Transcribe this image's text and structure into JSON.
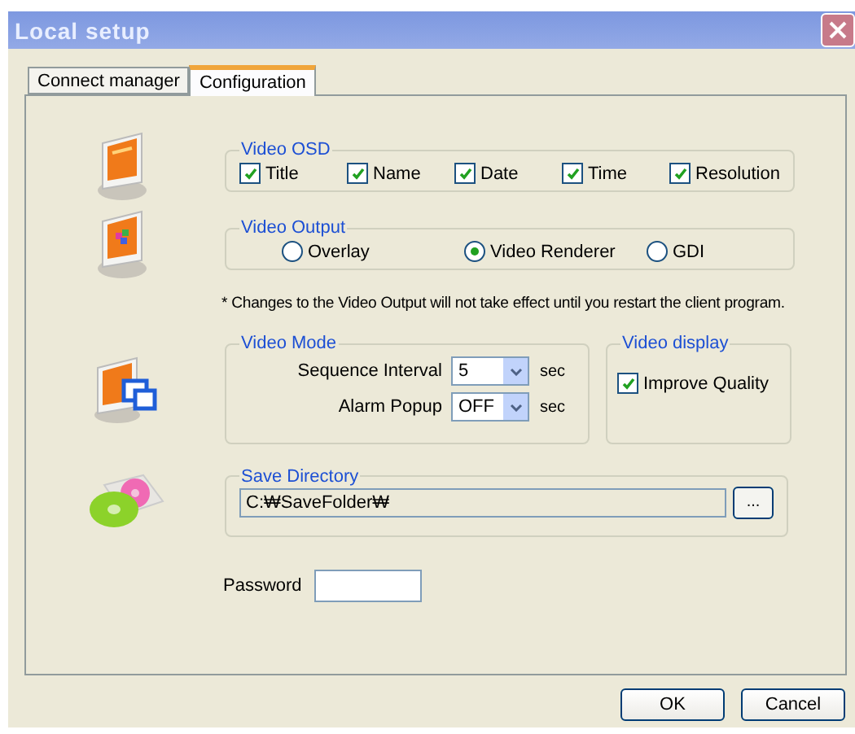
{
  "window": {
    "title": "Local setup"
  },
  "tabs": [
    {
      "label": "Connect manager",
      "selected": false
    },
    {
      "label": "Configuration",
      "selected": true
    }
  ],
  "video_osd": {
    "title": "Video OSD",
    "options": [
      {
        "label": "Title",
        "checked": true
      },
      {
        "label": "Name",
        "checked": true
      },
      {
        "label": "Date",
        "checked": true
      },
      {
        "label": "Time",
        "checked": true
      },
      {
        "label": "Resolution",
        "checked": true
      }
    ]
  },
  "video_output": {
    "title": "Video Output",
    "options": [
      {
        "label": "Overlay",
        "selected": false
      },
      {
        "label": "Video Renderer",
        "selected": true
      },
      {
        "label": "GDI",
        "selected": false
      }
    ]
  },
  "note": "* Changes to the Video Output will not take effect until you restart the client program.",
  "video_mode": {
    "title": "Video Mode",
    "fields": [
      {
        "label": "Sequence Interval",
        "value": "5",
        "unit": "sec"
      },
      {
        "label": "Alarm Popup",
        "value": "OFF",
        "unit": "sec"
      }
    ]
  },
  "video_display": {
    "title": "Video display",
    "options": [
      {
        "label": "Improve Quality",
        "checked": true
      }
    ]
  },
  "save_directory": {
    "title": "Save Directory",
    "value": "C:₩SaveFolder₩",
    "browse_button": "..."
  },
  "password": {
    "label": "Password"
  },
  "buttons": [
    "OK",
    "Cancel"
  ]
}
